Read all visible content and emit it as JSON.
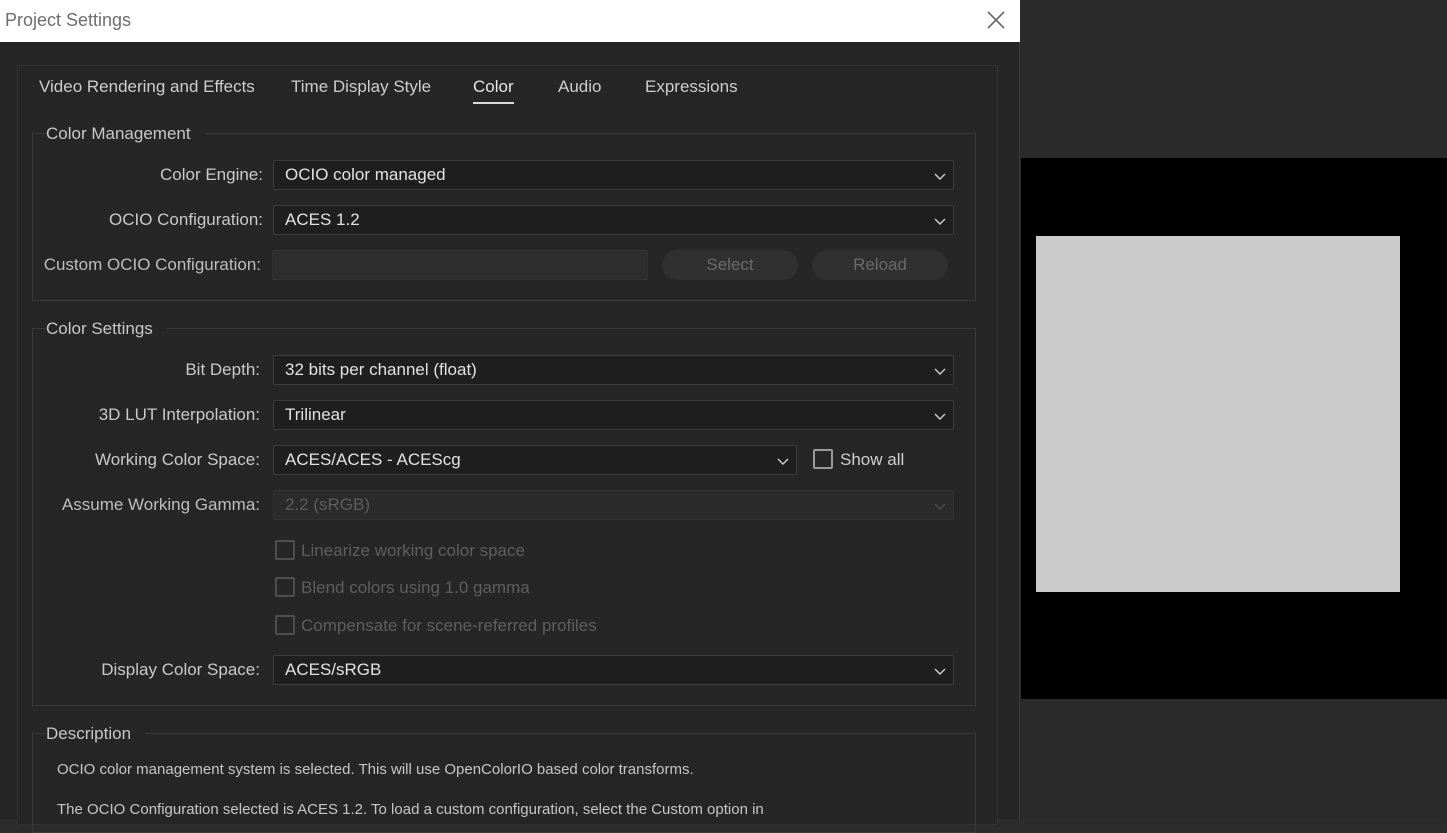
{
  "window": {
    "title": "Project Settings"
  },
  "tabs": [
    {
      "label": "Video Rendering and Effects"
    },
    {
      "label": "Time Display Style"
    },
    {
      "label": "Color"
    },
    {
      "label": "Audio"
    },
    {
      "label": "Expressions"
    }
  ],
  "active_tab": "Color",
  "color_management": {
    "group_label": "Color Management",
    "color_engine_label": "Color Engine:",
    "color_engine_value": "OCIO color managed",
    "ocio_config_label": "OCIO Configuration:",
    "ocio_config_value": "ACES 1.2",
    "custom_ocio_label": "Custom OCIO Configuration:",
    "custom_ocio_value": "",
    "select_button": "Select",
    "reload_button": "Reload"
  },
  "color_settings": {
    "group_label": "Color Settings",
    "bit_depth_label": "Bit Depth:",
    "bit_depth_value": "32 bits per channel (float)",
    "lut_label": "3D LUT Interpolation:",
    "lut_value": "Trilinear",
    "working_space_label": "Working Color Space:",
    "working_space_value": "ACES/ACES - ACEScg",
    "show_all_label": "Show all",
    "show_all_checked": false,
    "gamma_label": "Assume Working Gamma:",
    "gamma_value": "2.2 (sRGB)",
    "linearize_label": "Linearize working color space",
    "blend_label": "Blend colors using 1.0 gamma",
    "compensate_label": "Compensate for scene-referred profiles",
    "display_space_label": "Display Color Space:",
    "display_space_value": "ACES/sRGB"
  },
  "description": {
    "group_label": "Description",
    "line1": "OCIO color management system is selected. This will use OpenColorIO based color transforms.",
    "line2": "The OCIO Configuration selected is ACES 1.2. To load a custom configuration, select the Custom option in"
  },
  "colors": {
    "dialog_bg": "#262626",
    "titlebar_bg": "#ffffff",
    "preview_gray": "#cbcbcb"
  }
}
